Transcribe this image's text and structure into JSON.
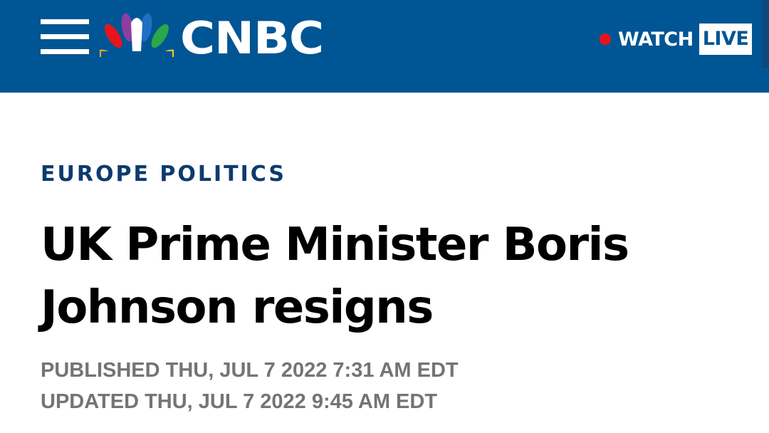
{
  "header": {
    "brand": "CNBC",
    "logo_icon": "nbc-peacock-icon",
    "menu_icon": "hamburger-menu-icon",
    "watch_label": "WATCH",
    "live_label": "LIVE",
    "colors": {
      "header_bg": "#005594",
      "live_dot": "#e8141b",
      "live_box_bg": "#ffffff"
    }
  },
  "article": {
    "section": "EUROPE POLITICS",
    "headline": "UK Prime Minister Boris Johnson resigns",
    "published": "PUBLISHED THU, JUL 7 2022 7:31 AM EDT",
    "updated": "UPDATED THU, JUL 7 2022 9:45 AM EDT",
    "colors": {
      "section": "#0c3b6e",
      "headline": "#000000",
      "timestamp": "#747474"
    }
  }
}
